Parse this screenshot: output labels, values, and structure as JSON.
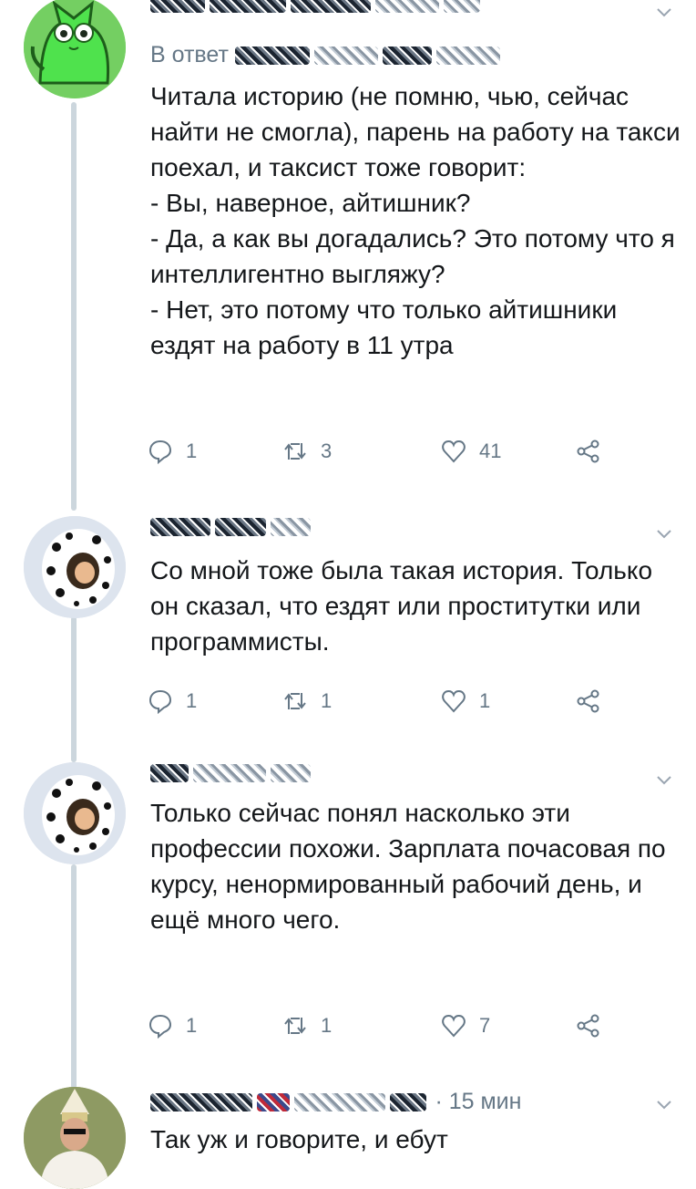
{
  "tweets": [
    {
      "reply_prefix": "В ответ",
      "text": "Читала историю (не помню, чью, сейчас найти не смогла), парень на работу на такси поехал, и таксист тоже говорит:\n- Вы, наверное, айтишник?\n- Да, а как вы догадались? Это потому что я интеллигентно выгляжу?\n- Нет, это потому что только айтишники ездят на работу в 11 утра",
      "replies": "1",
      "retweets": "3",
      "likes": "41"
    },
    {
      "text": "Со мной тоже была такая история. Только он сказал, что ездят или проститутки или программисты.",
      "replies": "1",
      "retweets": "1",
      "likes": "1"
    },
    {
      "text": "Только сейчас понял насколько эти профессии похожи. Зарплата почасовая по курсу, ненормированный рабочий день, и ещё много чего.",
      "replies": "1",
      "retweets": "1",
      "likes": "7"
    },
    {
      "time": "· 15 мин",
      "text": "Так уж и говорите, и ебут"
    }
  ],
  "colors": {
    "text": "#14171a",
    "secondary": "#657786",
    "thread_line": "#ccd6dd"
  },
  "icons": [
    "reply-icon",
    "retweet-icon",
    "like-icon",
    "share-icon",
    "chevron-down-icon"
  ]
}
